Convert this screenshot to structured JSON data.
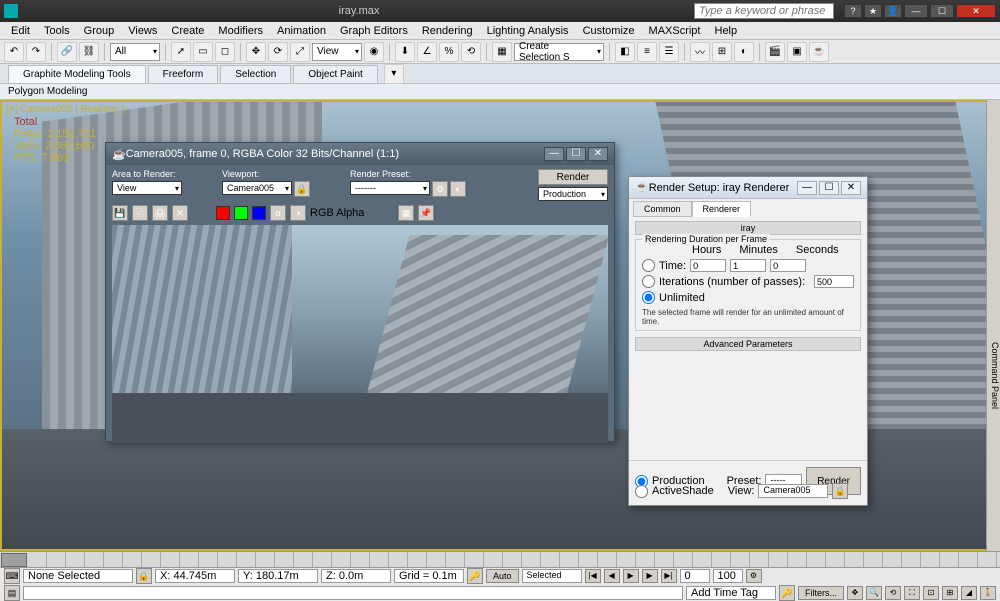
{
  "app": {
    "title": "iray.max",
    "search_placeholder": "Type a keyword or phrase"
  },
  "menu": [
    "Edit",
    "Tools",
    "Group",
    "Views",
    "Create",
    "Modifiers",
    "Animation",
    "Graph Editors",
    "Rendering",
    "Lighting Analysis",
    "Customize",
    "MAXScript",
    "Help"
  ],
  "toolbar": {
    "dropdown1": "All",
    "view_drop": "View",
    "create_drop": "Create Selection S"
  },
  "ribbon": {
    "tabs": [
      "Graphite Modeling Tools",
      "Freeform",
      "Selection",
      "Object Paint"
    ],
    "sub": "Polygon Modeling"
  },
  "viewport": {
    "label": "[+] Camera005 | Realistic ]",
    "stats": {
      "total": "Total",
      "polys": "Polys: 3,158,751",
      "verts": "Verts: 2,065,680",
      "fps": "FPS: 7.869"
    }
  },
  "render_window": {
    "title": "Camera005, frame 0, RGBA Color 32 Bits/Channel (1:1)",
    "area_label": "Area to Render:",
    "area_value": "View",
    "viewport_label": "Viewport:",
    "viewport_value": "Camera005",
    "preset_label": "Render Preset:",
    "preset_value": "-------",
    "render_btn": "Render",
    "production_btn": "Production",
    "alpha_label": "RGB Alpha"
  },
  "render_setup": {
    "title": "Render Setup: iray Renderer",
    "tabs": [
      "Common",
      "Renderer"
    ],
    "rollout": "iray",
    "group": "Rendering Duration per Frame",
    "time_units": [
      "Hours",
      "Minutes",
      "Seconds"
    ],
    "opt_time": "Time:",
    "time_h": "0",
    "time_m": "1",
    "time_s": "0",
    "opt_iter": "Iterations (number of passes):",
    "iter_value": "500",
    "opt_unlim": "Unlimited",
    "hint": "The selected frame will render for an unlimited amount of time.",
    "adv": "Advanced Parameters",
    "production": "Production",
    "activeshade": "ActiveShade",
    "preset_lbl": "Preset:",
    "preset_val": "-------",
    "view_lbl": "View:",
    "view_val": "Camera005",
    "render_btn": "Render"
  },
  "status": {
    "none": "None Selected",
    "x": "X: 44.745m",
    "y": "Y: 180.17m",
    "z": "Z: 0.0m",
    "grid": "Grid = 0.1m",
    "auto": "Auto",
    "selected": "Selected",
    "frame": "0",
    "frame_max": "100",
    "add_tag": "Add Time Tag",
    "filters": "Filters..."
  },
  "panel": {
    "label": "Command Panel"
  }
}
